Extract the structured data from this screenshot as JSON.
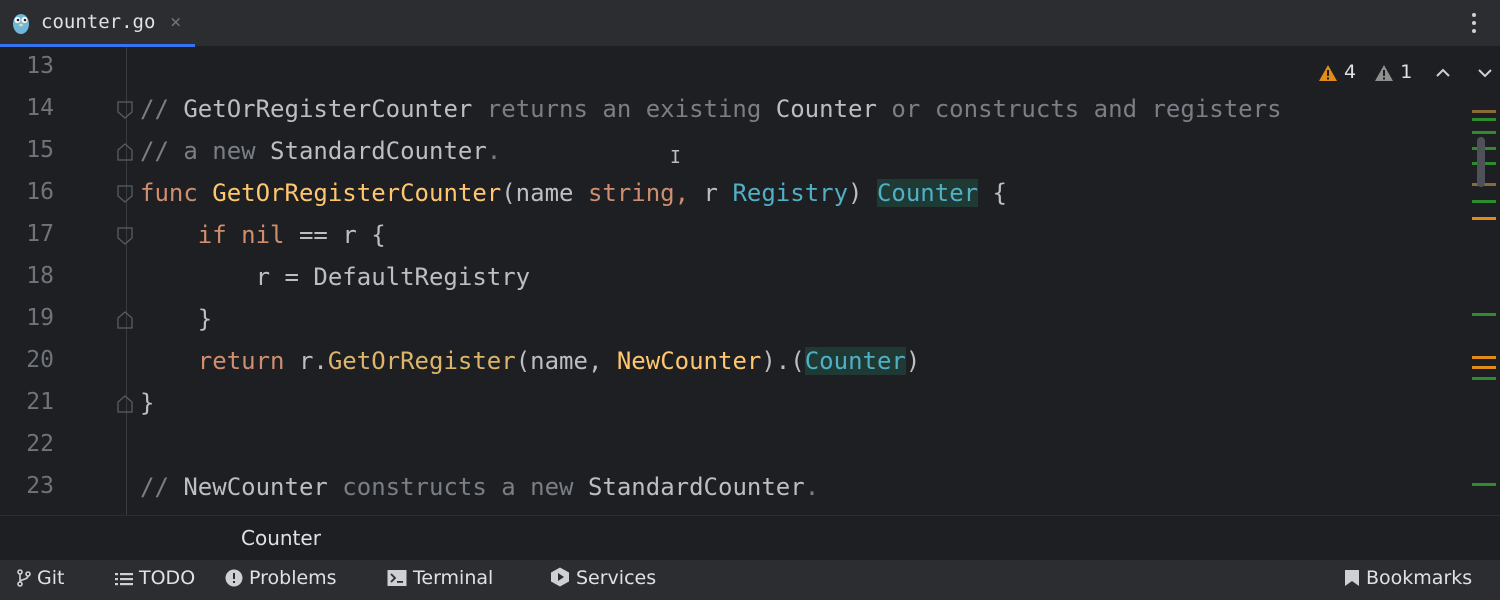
{
  "tab": {
    "filename": "counter.go",
    "close_symbol": "×",
    "icon": "gopher-icon"
  },
  "inspection": {
    "warnings_count": "4",
    "weak_warnings_count": "1",
    "warning_color": "#e08c1a",
    "weak_warning_color": "#8f8f8f"
  },
  "code_lines": [
    {
      "number": "13"
    },
    {
      "number": "14"
    },
    {
      "number": "15"
    },
    {
      "number": "16"
    },
    {
      "number": "17"
    },
    {
      "number": "18"
    },
    {
      "number": "19"
    },
    {
      "number": "20"
    },
    {
      "number": "21"
    },
    {
      "number": "22"
    },
    {
      "number": "23"
    }
  ],
  "code": {
    "l14": {
      "t1": "// ",
      "t2": "GetOrRegisterCounter",
      "t3": " returns an existing ",
      "t4": "Counter",
      "t5": " or constructs and registers"
    },
    "l15": {
      "t1": "// a new ",
      "t2": "StandardCounter",
      "t3": "."
    },
    "l16": {
      "t1": "func ",
      "t2": "GetOrRegisterCounter",
      "t3": "(name ",
      "t4": "string",
      "t5": ", ",
      "t6": "r ",
      "t7": "Registry",
      "t8": ") ",
      "t9": "Counter",
      "t10": " {"
    },
    "l17": {
      "t1": "    if ",
      "t2": "nil",
      "t3": " == r {"
    },
    "l18": {
      "t1": "        r = DefaultRegistry"
    },
    "l19": {
      "t1": "    }"
    },
    "l20": {
      "t1": "    return ",
      "t2": "r.",
      "t3": "GetOrRegister",
      "t4": "(name, ",
      "t5": "NewCounter",
      "t6": ").(",
      "t7": "Counter",
      "t8": ")"
    },
    "l21": {
      "t1": "}"
    },
    "l23": {
      "t1": "// ",
      "t2": "NewCounter",
      "t3": " constructs a new ",
      "t4": "StandardCounter",
      "t5": "."
    }
  },
  "breadcrumb": {
    "label": "Counter"
  },
  "tool_windows": [
    {
      "label": "Git",
      "icon": "git-branch-icon"
    },
    {
      "label": "TODO",
      "icon": "list-icon"
    },
    {
      "label": "Problems",
      "icon": "problems-icon"
    },
    {
      "label": "Terminal",
      "icon": "terminal-icon"
    },
    {
      "label": "Services",
      "icon": "services-icon"
    },
    {
      "label": "Bookmarks",
      "icon": "bookmark-icon"
    }
  ],
  "colors": {
    "accent": "#3574f0",
    "marker_orange": "#e08c1a",
    "marker_green": "#2e8b2e"
  }
}
